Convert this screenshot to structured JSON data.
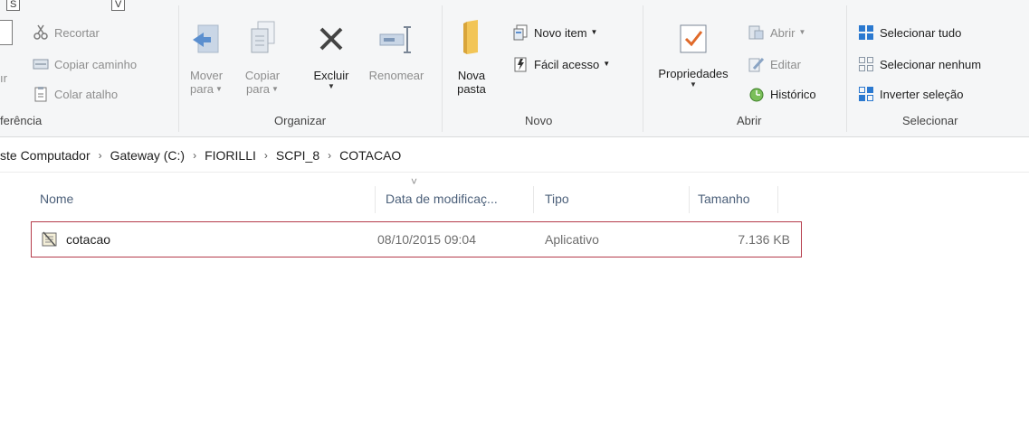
{
  "key_tips": [
    "S",
    "V"
  ],
  "clipboard": {
    "group_label": "ferência",
    "partial_button_label": "ır",
    "cut_label": "Recortar",
    "copy_path_label": "Copiar caminho",
    "paste_shortcut_label": "Colar atalho"
  },
  "organize": {
    "group_label": "Organizar",
    "move_to_label_1": "Mover",
    "move_to_label_2": "para",
    "copy_to_label_1": "Copiar",
    "copy_to_label_2": "para",
    "delete_label": "Excluir",
    "rename_label": "Renomear"
  },
  "new": {
    "group_label": "Novo",
    "new_folder_label_1": "Nova",
    "new_folder_label_2": "pasta",
    "new_item_label": "Novo item",
    "easy_access_label": "Fácil acesso"
  },
  "open": {
    "group_label": "Abrir",
    "properties_label": "Propriedades",
    "open_label": "Abrir",
    "edit_label": "Editar",
    "history_label": "Histórico"
  },
  "select": {
    "group_label": "Selecionar",
    "select_all_label": "Selecionar tudo",
    "select_none_label": "Selecionar nenhum",
    "invert_label": "Inverter seleção"
  },
  "address": {
    "crumbs": [
      "ste Computador",
      "Gateway (C:)",
      "FIORILLI",
      "SCPI_8",
      "COTACAO"
    ],
    "separator": "›"
  },
  "columns": {
    "name": "Nome",
    "modified": "Data de modificaç...",
    "type": "Tipo",
    "size": "Tamanho",
    "sort_indicator": "˅"
  },
  "file": {
    "name": "cotacao",
    "modified": "08/10/2015 09:04",
    "type": "Aplicativo",
    "size": "7.136 KB",
    "icon": "application-icon"
  },
  "colors": {
    "ribbon_bg": "#f5f6f7",
    "selection_border": "#b53b4a",
    "header_text": "#4c607a",
    "accent_blue": "#2b79d0",
    "folder_yellow": "#e8b64a"
  }
}
